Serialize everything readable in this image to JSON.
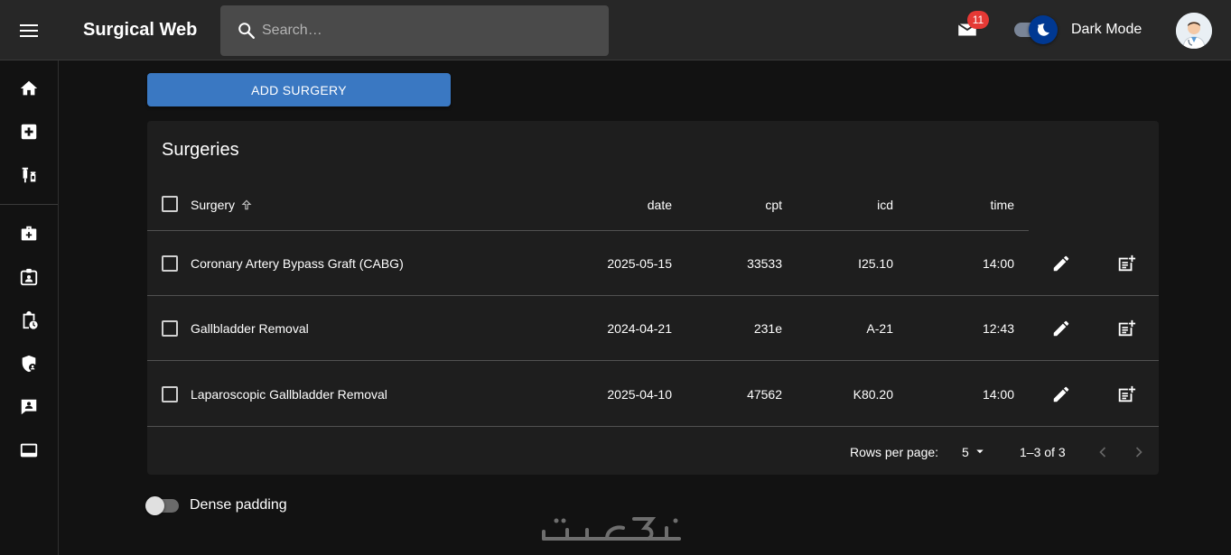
{
  "app": {
    "title": "Surgical Web"
  },
  "search": {
    "placeholder": "Search…"
  },
  "header": {
    "mail_badge": "11",
    "theme_label": "Dark Mode"
  },
  "sidebar": {
    "items": [
      {
        "icon": "home-icon"
      },
      {
        "icon": "medical-plus-icon"
      },
      {
        "icon": "vaccines-icon"
      },
      {
        "icon": "medical-bag-icon"
      },
      {
        "icon": "badge-icon"
      },
      {
        "icon": "clipboard-clock-icon"
      },
      {
        "icon": "shield-person-icon"
      },
      {
        "icon": "contact-card-icon"
      },
      {
        "icon": "monitor-icon"
      }
    ]
  },
  "toolbar": {
    "add_label": "ADD SURGERY"
  },
  "table": {
    "title": "Surgeries",
    "columns": {
      "surgery": "Surgery",
      "date": "date",
      "cpt": "cpt",
      "icd": "icd",
      "time": "time"
    },
    "rows": [
      {
        "surgery": "Coronary Artery Bypass Graft (CABG)",
        "date": "2025-05-15",
        "cpt": "33533",
        "icd": "I25.10",
        "time": "14:00"
      },
      {
        "surgery": "Gallbladder Removal",
        "date": "2024-04-21",
        "cpt": "231e",
        "icd": "A-21",
        "time": "12:43"
      },
      {
        "surgery": "Laparoscopic Gallbladder Removal",
        "date": "2025-04-10",
        "cpt": "47562",
        "icd": "K80.20",
        "time": "14:00"
      }
    ]
  },
  "pagination": {
    "rows_per_page_label": "Rows per page:",
    "rows_per_page": "5",
    "range": "1–3 of 3"
  },
  "footer": {
    "dense_label": "Dense padding"
  },
  "colors": {
    "primary": "#3a78c2",
    "badge": "#e53935",
    "theme_thumb": "#003892"
  }
}
